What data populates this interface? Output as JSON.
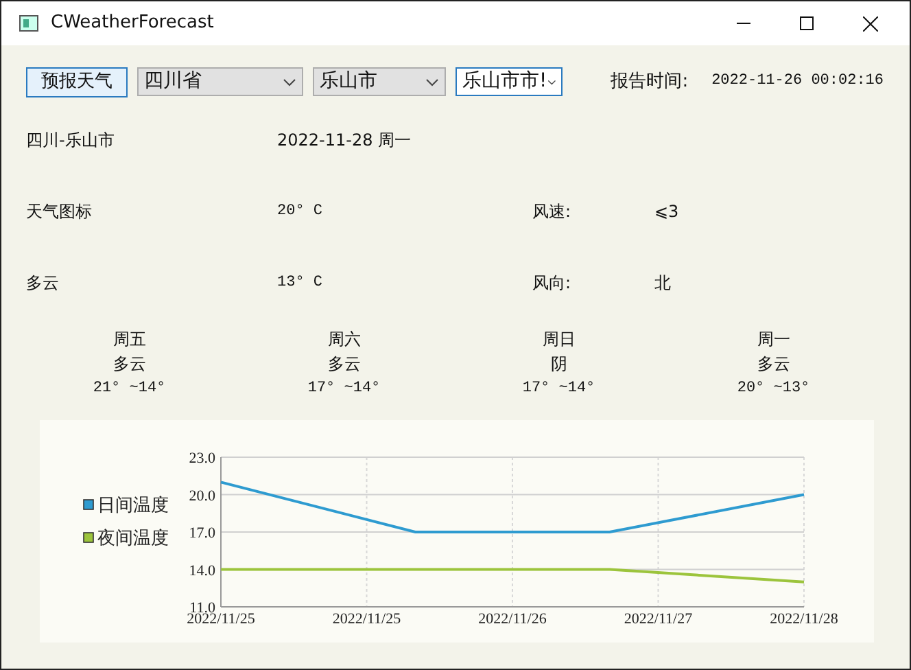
{
  "window": {
    "title": "CWeatherForecast"
  },
  "toolbar": {
    "forecast_button": "预报天气",
    "province": "四川省",
    "city": "乐山市",
    "district": "乐山市市!",
    "report_label": "报告时间:",
    "report_time": "2022-11-26 00:02:16"
  },
  "today": {
    "location": "四川-乐山市",
    "date": "2022-11-28 周一",
    "icon_label": "天气图标",
    "high": "20° C",
    "wind_speed_label": "风速:",
    "wind_speed": "⩽3",
    "condition": "多云",
    "low": "13° C",
    "wind_dir_label": "风向:",
    "wind_dir": "北"
  },
  "forecast": [
    {
      "day": "周五",
      "condition": "多云",
      "range": "21° ~14°"
    },
    {
      "day": "周六",
      "condition": "多云",
      "range": "17° ~14°"
    },
    {
      "day": "周日",
      "condition": "阴",
      "range": "17° ~14°"
    },
    {
      "day": "周一",
      "condition": "多云",
      "range": "20° ~13°"
    }
  ],
  "chart": {
    "chart_data": {
      "type": "line",
      "categories": [
        "2022/11/25",
        null,
        null,
        "2022/11/25",
        null,
        null,
        "2022/11/26",
        null,
        null,
        "2022/11/27",
        null,
        null,
        "2022/11/28"
      ],
      "ylim": [
        11,
        23
      ],
      "grid": true,
      "legend": "left",
      "yticks": [
        {
          "value": 23,
          "label": "23.0"
        },
        {
          "value": 20,
          "label": "20.0"
        },
        {
          "value": 17,
          "label": "17.0"
        },
        {
          "value": 14,
          "label": "14.0"
        },
        {
          "value": 11,
          "label": "11.0"
        }
      ],
      "series": [
        {
          "name": "日间温度",
          "color": "#2e9bd0",
          "values": [
            21,
            null,
            null,
            null,
            17,
            null,
            null,
            null,
            17,
            null,
            null,
            null,
            20
          ]
        },
        {
          "name": "夜间温度",
          "color": "#9cc43c",
          "values": [
            14,
            null,
            null,
            null,
            14,
            null,
            null,
            null,
            14,
            null,
            null,
            null,
            13
          ]
        }
      ]
    }
  }
}
